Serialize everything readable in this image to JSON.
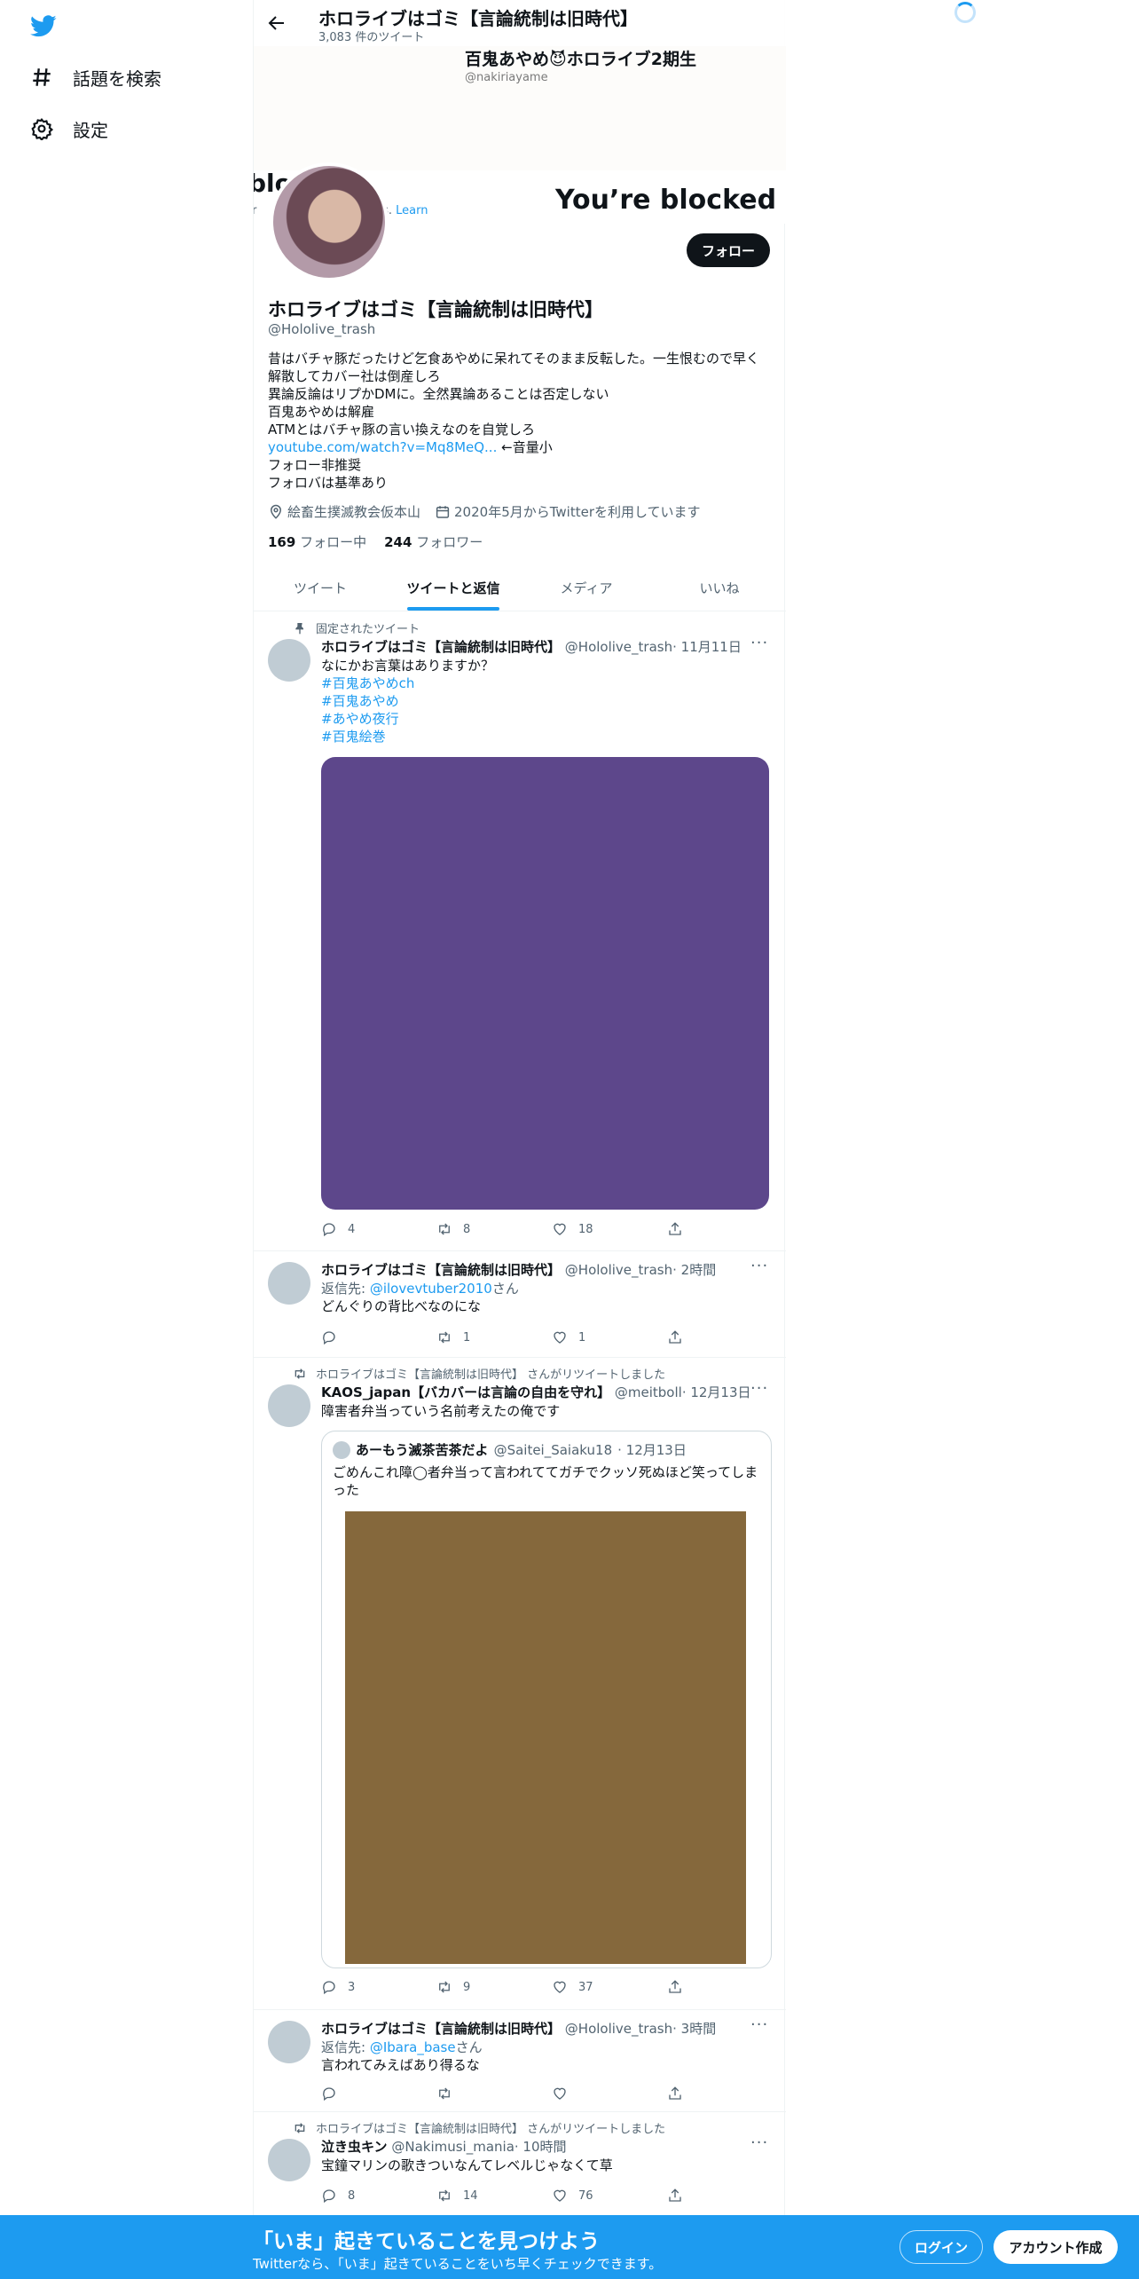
{
  "nav": {
    "items": [
      {
        "label": "話題を検索",
        "icon": "hashtag-icon"
      },
      {
        "label": "設定",
        "icon": "gear-icon"
      }
    ]
  },
  "header": {
    "title": "ホロライブはゴミ【言論統制は旧時代】",
    "tweet_count": "3,083 件のツイート"
  },
  "banner": {
    "name": "百鬼あやめ😈ホロライブ2期生",
    "handle": "@nakiriayame",
    "blocked_text": "You’re blocked",
    "frag_left": "blo",
    "frag_left_small": "r",
    "frag_right": "ts. Learn"
  },
  "profile": {
    "follow_label": "フォロー",
    "name": "ホロライブはゴミ【言論統制は旧時代】",
    "handle": "@Hololive_trash",
    "bio": [
      "昔はバチャ豚だったけど乞食あやめに呆れてそのまま反転した。一生恨むので早く",
      "解散してカバー社は倒産しろ",
      "異論反論はリプかDMに。全然異論あることは否定しない",
      "百鬼あやめは解雇",
      "ATMとはバチャ豚の言い換えなのを自覚しろ"
    ],
    "bio_link": "youtube.com/watch?v=Mq8MeQ...",
    "bio_link_suffix": " ←音量小",
    "bio_tail": [
      "フォロー非推奨",
      "フォロバは基準あり"
    ],
    "location": "絵畜生撲滅教会仮本山",
    "joined": "2020年5月からTwitterを利用しています",
    "following_count": "169",
    "following_label": "フォロー中",
    "followers_count": "244",
    "followers_label": "フォロワー"
  },
  "tabs": [
    "ツイート",
    "ツイートと返信",
    "メディア",
    "いいね"
  ],
  "tweets": [
    {
      "context": "固定されたツイート",
      "name": "ホロライブはゴミ【言論統制は旧時代】",
      "handle": "@Hololive_trash",
      "time": "· 11月11日",
      "text": [
        "なにかお言葉はありますか？"
      ],
      "hashtags": [
        "#百鬼あやめch",
        "#百鬼あやめ",
        "#あやめ夜行",
        "#百鬼絵巻"
      ],
      "media_color": "#5d478b",
      "replies": "4",
      "retweets": "8",
      "likes": "18"
    },
    {
      "name": "ホロライブはゴミ【言論統制は旧時代】",
      "handle": "@Hololive_trash",
      "time": "· 2時間",
      "reply_to_label": "返信先: ",
      "reply_to": "@ilovevtuber2010",
      "reply_suffix": "さん",
      "text": [
        "どんぐりの背比べなのにな"
      ],
      "replies": "",
      "retweets": "1",
      "likes": "1"
    },
    {
      "context": "ホロライブはゴミ【言論統制は旧時代】 さんがリツイートしました",
      "name": "KAOS_japan【バカバーは言論の自由を守れ】",
      "handle": "@meitboll",
      "time": "· 12月13日",
      "text": [
        "障害者弁当っていう名前考えたの俺です"
      ],
      "quote": {
        "name": "あーもう滅茶苦茶だよ",
        "handle": "@Saitei_Saiaku18",
        "time": "· 12月13日",
        "text": [
          "ごめんこれ障◯者弁当って言われててガチでクッソ死ぬほど笑ってしま",
          "った"
        ],
        "media_color": "#85683c"
      },
      "replies": "3",
      "retweets": "9",
      "likes": "37"
    },
    {
      "name": "ホロライブはゴミ【言論統制は旧時代】",
      "handle": "@Hololive_trash",
      "time": "· 3時間",
      "reply_to_label": "返信先: ",
      "reply_to": "@Ibara_base",
      "reply_suffix": "さん",
      "text": [
        "言われてみえばあり得るな"
      ],
      "replies": "",
      "retweets": "",
      "likes": ""
    },
    {
      "context": "ホロライブはゴミ【言論統制は旧時代】 さんがリツイートしました",
      "name": "泣き虫キン",
      "handle": "@Nakimusi_mania",
      "time": "· 10時間",
      "text": [
        "宝鐘マリンの歌きついなんてレベルじゃなくて草"
      ],
      "replies": "8",
      "retweets": "14",
      "likes": "76"
    }
  ],
  "bottombar": {
    "title": "「いま」起きていることを見つけよう",
    "subtitle": "Twitterなら、「いま」起きていることをいち早くチェックできます。",
    "login": "ログイン",
    "signup": "アカウント作成"
  },
  "colors": {
    "accent": "#1d9bf0",
    "text": "#0f1419",
    "secondary": "#536471"
  }
}
